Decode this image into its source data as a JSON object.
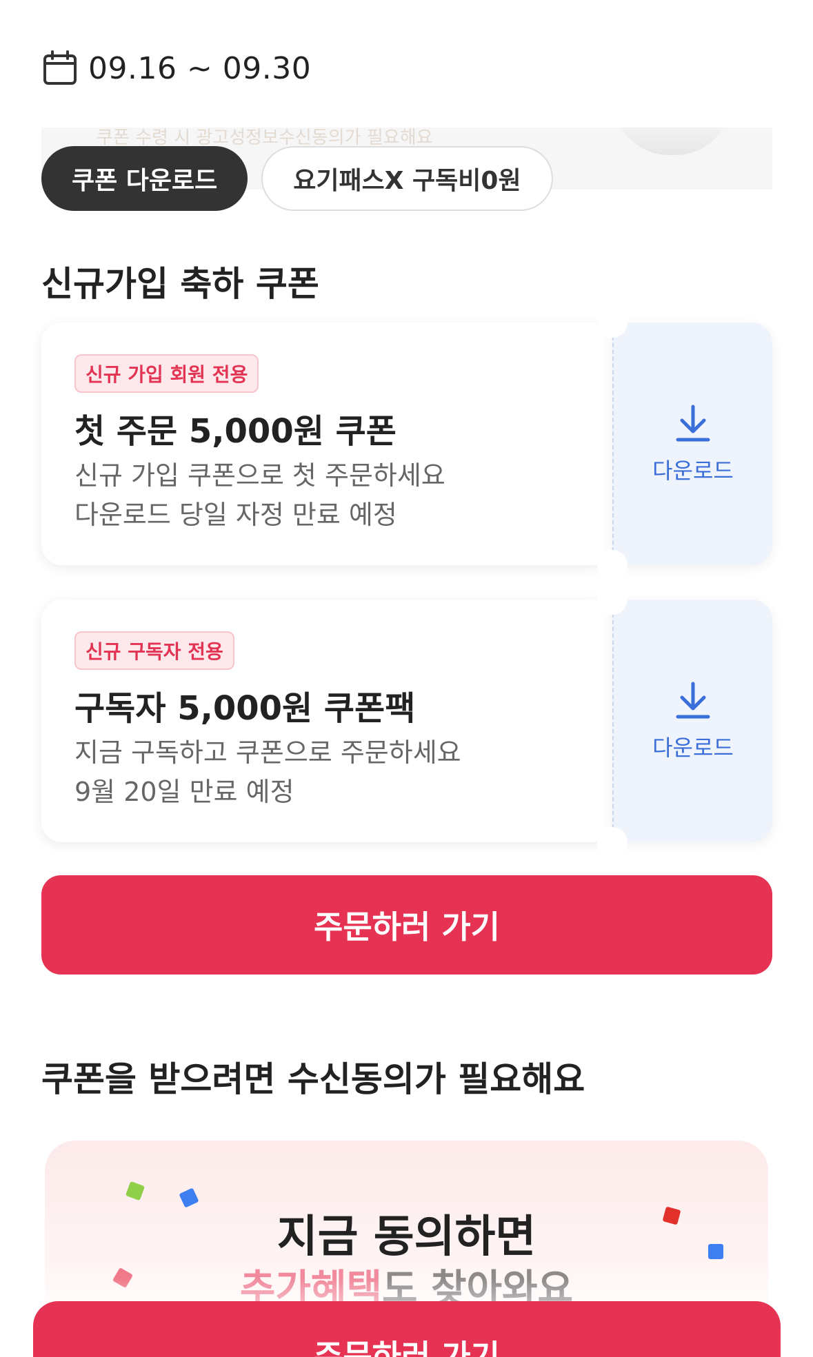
{
  "header": {
    "date_range": "09.16 ~ 09.30",
    "calendar_icon": "calendar-icon"
  },
  "banner_peek": {
    "text": "쿠폰 수령 시 광고성정보수신동의가 필요해요"
  },
  "tabs": [
    {
      "label": "쿠폰 다운로드",
      "active": true
    },
    {
      "label": "요기패스X 구독비0원",
      "active": false
    }
  ],
  "section_new": {
    "title": "신규가입 축하 쿠폰"
  },
  "coupons": [
    {
      "badge": "신규 가입 회원 전용",
      "title": "첫 주문 5,000원 쿠폰",
      "desc_line1": "신규 가입 쿠폰으로 첫 주문하세요",
      "desc_line2": "다운로드 당일 자정 만료 예정",
      "download_label": "다운로드",
      "download_icon": "download-icon"
    },
    {
      "badge": "신규 구독자 전용",
      "title": "구독자 5,000원 쿠폰팩",
      "desc_line1": "지금 구독하고 쿠폰으로 주문하세요",
      "desc_line2": "9월 20일 만료 예정",
      "download_label": "다운로드",
      "download_icon": "download-icon"
    }
  ],
  "cta": {
    "label": "주문하러 가기"
  },
  "section_consent": {
    "title": "쿠폰을 받으려면 수신동의가 필요해요"
  },
  "promo": {
    "line1": "지금 동의하면",
    "line2_highlight": "추가혜택",
    "line2_rest": "도 찾아와요"
  },
  "bottom_cta": {
    "label": "주문하러 가기"
  },
  "colors": {
    "accent": "#e63354",
    "badge_bg": "#fde8eb",
    "download_blue": "#3a6ed8",
    "stub_bg": "#eef3fc",
    "active_tab": "#333333"
  }
}
